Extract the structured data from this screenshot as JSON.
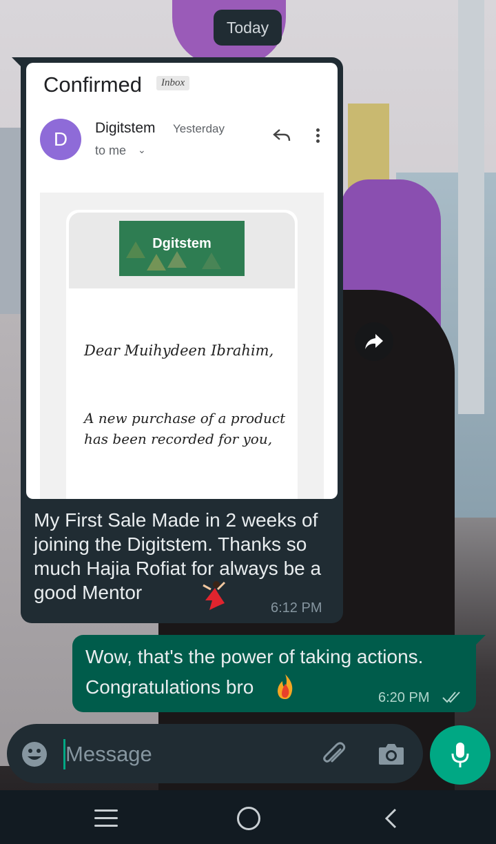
{
  "date_chip": "Today",
  "incoming": {
    "email": {
      "subject": "Confirmed",
      "label": "Inbox",
      "avatar_letter": "D",
      "sender": "Digitstem",
      "time": "Yesterday",
      "to": "to me",
      "brand": "Dgitstem",
      "greeting": "Dear Muihydeen Ibrahim,",
      "body": "A new purchase of a product has been recorded for you,"
    },
    "caption": "My First Sale Made in 2 weeks of joining the Digitstem. Thanks so much Hajia Rofiat for always be a good Mentor",
    "time": "6:12 PM"
  },
  "outgoing": {
    "text": "Wow, that's the power of taking actions. Congratulations bro",
    "time": "6:20 PM"
  },
  "composer": {
    "placeholder": "Message"
  },
  "colors": {
    "incoming_bubble": "#202c33",
    "outgoing_bubble": "#005c4b",
    "accent": "#00a884"
  },
  "icons": [
    "emoji-icon",
    "attach-icon",
    "camera-icon",
    "mic-icon",
    "reply-icon",
    "more-icon",
    "forward-icon"
  ]
}
